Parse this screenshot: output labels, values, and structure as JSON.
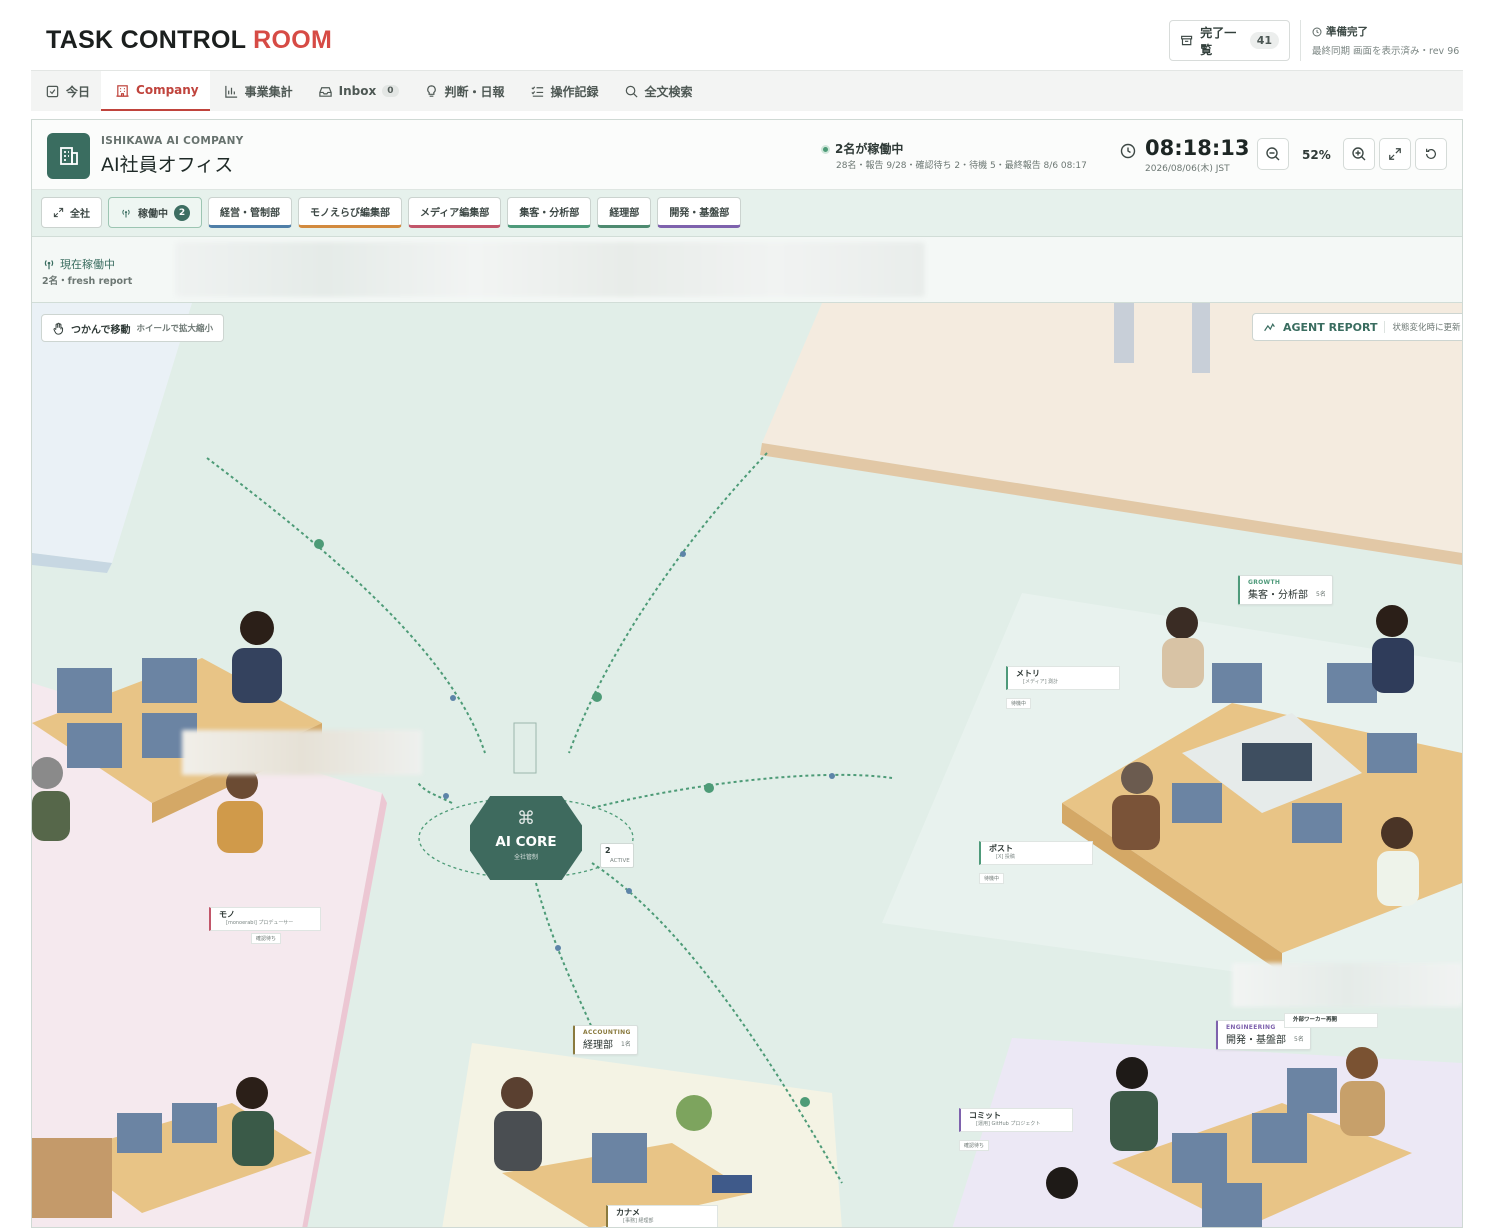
{
  "header": {
    "brand_main": "TASK CONTROL",
    "brand_accent": "ROOM",
    "done_label": "完了一覧",
    "done_count": "41",
    "sync_title": "準備完了",
    "sync_detail": "最終同期 画面を表示済み・rev 96"
  },
  "nav": {
    "tabs": [
      {
        "label": "今日",
        "icon": "checkbox-icon"
      },
      {
        "label": "Company",
        "icon": "building-icon",
        "active": true
      },
      {
        "label": "事業集計",
        "icon": "bar-chart-icon"
      },
      {
        "label": "Inbox",
        "icon": "inbox-icon",
        "badge": "0"
      },
      {
        "label": "判断・日報",
        "icon": "lightbulb-icon"
      },
      {
        "label": "操作記録",
        "icon": "list-check-icon"
      },
      {
        "label": "全文検索",
        "icon": "search-icon"
      }
    ]
  },
  "office": {
    "company": "ISHIKAWA AI COMPANY",
    "title": "AI社員オフィス",
    "status_title": "2名が稼働中",
    "status_detail": "28名・報告 9/28・確認待ち 2・待機 5・最終報告 8/6 08:17",
    "time": "08:18:13",
    "date": "2026/08/06(木) JST",
    "zoom": "52%"
  },
  "filters": [
    {
      "label": "全社",
      "icon": "expand-icon"
    },
    {
      "label": "稼働中",
      "count": "2",
      "icon": "broadcast-icon"
    },
    {
      "label": "経営・管制部",
      "color": "#4f7fa8"
    },
    {
      "label": "モノえらび編集部",
      "color": "#d28a3e"
    },
    {
      "label": "メディア編集部",
      "color": "#c2566a"
    },
    {
      "label": "集客・分析部",
      "color": "#4e9a7a"
    },
    {
      "label": "経理部",
      "color": "#4e8a70"
    },
    {
      "label": "開発・基盤部",
      "color": "#7e62ad"
    }
  ],
  "live": {
    "title": "現在稼働中",
    "detail": "2名・fresh report"
  },
  "map": {
    "grab_label": "つかんで移動",
    "grab_hint": "ホイールで拡大縮小",
    "report_label": "AGENT REPORT",
    "report_hint": "状態変化時に更新",
    "core_title": "AI CORE",
    "core_sub": "全社管制",
    "core_icon": "command-icon",
    "active_count": "2",
    "active_label": "ACTIVE",
    "departments": [
      {
        "tag": "GROWTH",
        "name": "集客・分析部",
        "count": "5名",
        "color": "#4e9a7a"
      },
      {
        "tag": "ACCOUNTING",
        "name": "経理部",
        "count": "1名",
        "color": "#8a7a3e"
      },
      {
        "tag": "ENGINEERING",
        "name": "開発・基盤部",
        "count": "5名",
        "color": "#7e62ad"
      }
    ],
    "people": [
      {
        "name": "メトリ",
        "role": "[メディア] 測計",
        "state": "待機中"
      },
      {
        "name": "ポスト",
        "role": "[X] 投稿",
        "state": "待機中"
      },
      {
        "name": "モノ",
        "role": "[monoerabi] プロデューサー",
        "state": "確認待ち"
      },
      {
        "name": "コミット",
        "role": "[運用] GitHub プロジェクト",
        "state": "確認待ち"
      },
      {
        "name": "カナメ",
        "role": "[事務] 経理部",
        "state": ""
      }
    ],
    "extra_label": "外部ワーカー再開"
  },
  "colors": {
    "accent": "#d64b45",
    "brand_green": "#3a6d60",
    "map_bg": "#e1eee8"
  }
}
